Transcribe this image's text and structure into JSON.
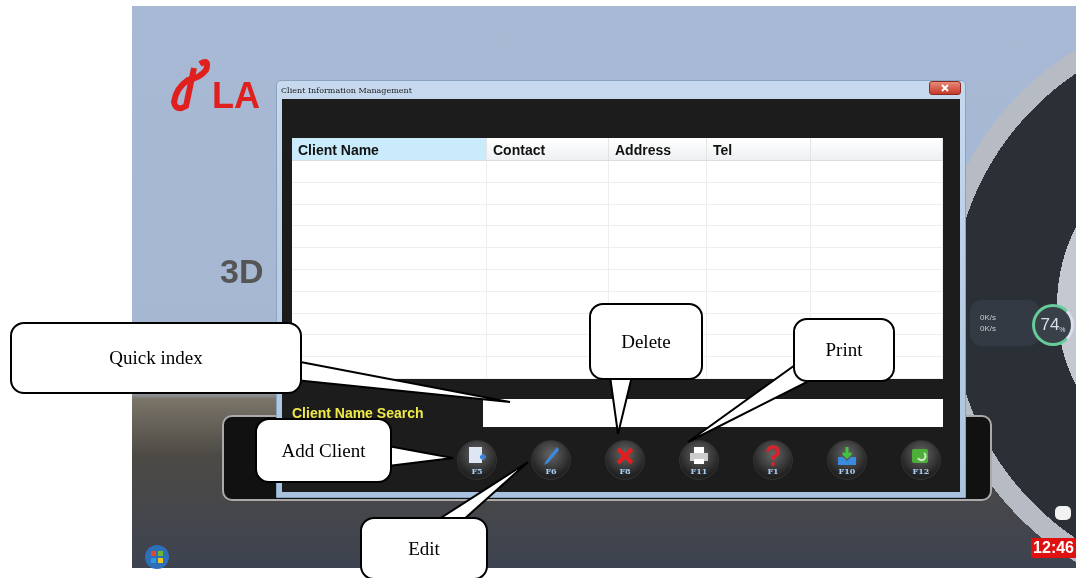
{
  "desktop": {
    "logo_text": "LA",
    "heading": "3D",
    "tray": {
      "upload": "0K/s",
      "download": "0K/s",
      "gauge": "74",
      "gauge_unit": "%"
    },
    "clock": "12:46"
  },
  "window": {
    "title": "Client Information Management"
  },
  "table": {
    "columns": [
      "Client Name",
      "Contact",
      "Address",
      "Tel",
      ""
    ]
  },
  "search": {
    "label": "Client Name Search"
  },
  "toolbar": [
    {
      "kind": "add",
      "key": "F5"
    },
    {
      "kind": "edit",
      "key": "F6"
    },
    {
      "kind": "delete",
      "key": "F8"
    },
    {
      "kind": "print",
      "key": "F11"
    },
    {
      "kind": "help",
      "key": "F1"
    },
    {
      "kind": "import",
      "key": "F10"
    },
    {
      "kind": "back",
      "key": "F12"
    }
  ],
  "callouts": [
    {
      "kind": "quick",
      "text": "Quick index"
    },
    {
      "kind": "delete",
      "text": "Delete"
    },
    {
      "kind": "print",
      "text": "Print"
    },
    {
      "kind": "add",
      "text": "Add Client"
    },
    {
      "kind": "edit",
      "text": "Edit"
    }
  ]
}
